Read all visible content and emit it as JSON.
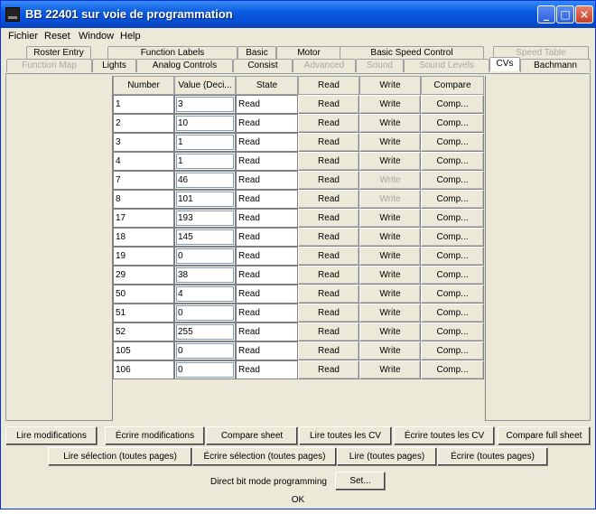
{
  "window": {
    "title": "BB 22401 sur voie de programmation",
    "min_label": "_",
    "max_label": "□",
    "close_label": "×"
  },
  "menu": [
    "Fichier",
    "Reset",
    "Window",
    "Help"
  ],
  "tabs_row1": [
    {
      "label": "Roster Entry",
      "disabled": false
    },
    {
      "label": "Function Labels",
      "disabled": false
    },
    {
      "label": "Basic",
      "disabled": false
    },
    {
      "label": "Motor",
      "disabled": false
    },
    {
      "label": "Basic Speed Control",
      "disabled": false
    },
    {
      "label": "Speed Table",
      "disabled": true
    }
  ],
  "tabs_row2": [
    {
      "label": "Function Map",
      "disabled": true
    },
    {
      "label": "Lights",
      "disabled": false
    },
    {
      "label": "Analog Controls",
      "disabled": false
    },
    {
      "label": "Consist",
      "disabled": false
    },
    {
      "label": "Advanced",
      "disabled": true
    },
    {
      "label": "Sound",
      "disabled": true
    },
    {
      "label": "Sound Levels",
      "disabled": true
    },
    {
      "label": "CVs",
      "disabled": false,
      "active": true
    },
    {
      "label": "Bachmann",
      "disabled": false
    }
  ],
  "table": {
    "headers": [
      "Number",
      "Value (Deci...",
      "State",
      "Read",
      "Write",
      "Compare"
    ],
    "read_label": "Read",
    "write_label": "Write",
    "compare_label": "Comp...",
    "rows": [
      {
        "number": "1",
        "value": "3",
        "state": "Read",
        "write_disabled": false
      },
      {
        "number": "2",
        "value": "10",
        "state": "Read",
        "write_disabled": false
      },
      {
        "number": "3",
        "value": "1",
        "state": "Read",
        "write_disabled": false
      },
      {
        "number": "4",
        "value": "1",
        "state": "Read",
        "write_disabled": false
      },
      {
        "number": "7",
        "value": "46",
        "state": "Read",
        "write_disabled": true
      },
      {
        "number": "8",
        "value": "101",
        "state": "Read",
        "write_disabled": true
      },
      {
        "number": "17",
        "value": "193",
        "state": "Read",
        "write_disabled": false
      },
      {
        "number": "18",
        "value": "145",
        "state": "Read",
        "write_disabled": false
      },
      {
        "number": "19",
        "value": "0",
        "state": "Read",
        "write_disabled": false
      },
      {
        "number": "29",
        "value": "38",
        "state": "Read",
        "write_disabled": false
      },
      {
        "number": "50",
        "value": "4",
        "state": "Read",
        "write_disabled": false
      },
      {
        "number": "51",
        "value": "0",
        "state": "Read",
        "write_disabled": false
      },
      {
        "number": "52",
        "value": "255",
        "state": "Read",
        "write_disabled": false
      },
      {
        "number": "105",
        "value": "0",
        "state": "Read",
        "write_disabled": false
      },
      {
        "number": "106",
        "value": "0",
        "state": "Read",
        "write_disabled": false
      }
    ]
  },
  "buttons_row1": [
    "Lire modifications",
    "Écrire modifications",
    "Compare sheet",
    "Lire toutes les CV",
    "Écrire toutes les CV",
    "Compare full sheet"
  ],
  "buttons_row2": [
    "Lire sélection (toutes pages)",
    "Écrire sélection (toutes pages)",
    "Lire (toutes pages)",
    "Écrire (toutes pages)"
  ],
  "mode": {
    "label": "Direct bit mode programming",
    "set_label": "Set..."
  },
  "status": "OK"
}
